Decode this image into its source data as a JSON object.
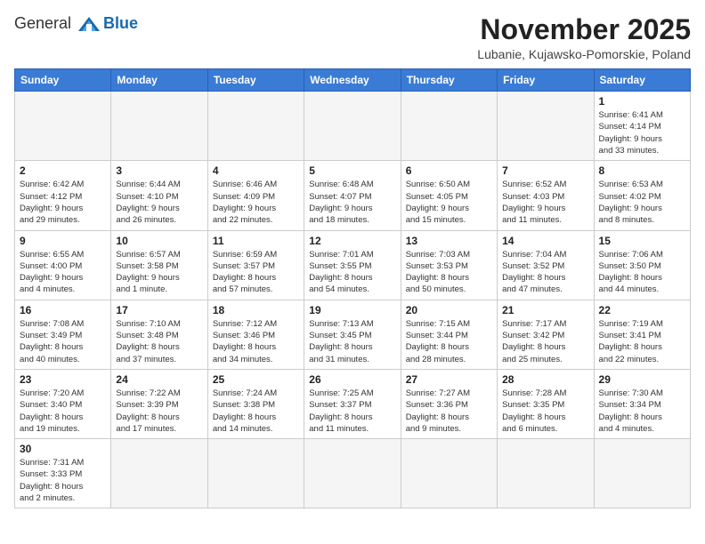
{
  "header": {
    "logo_general": "General",
    "logo_blue": "Blue",
    "title": "November 2025",
    "subtitle": "Lubanie, Kujawsko-Pomorskie, Poland"
  },
  "weekdays": [
    "Sunday",
    "Monday",
    "Tuesday",
    "Wednesday",
    "Thursday",
    "Friday",
    "Saturday"
  ],
  "days": [
    {
      "date": "",
      "info": ""
    },
    {
      "date": "",
      "info": ""
    },
    {
      "date": "",
      "info": ""
    },
    {
      "date": "",
      "info": ""
    },
    {
      "date": "",
      "info": ""
    },
    {
      "date": "",
      "info": ""
    },
    {
      "date": "1",
      "info": "Sunrise: 6:41 AM\nSunset: 4:14 PM\nDaylight: 9 hours\nand 33 minutes."
    },
    {
      "date": "2",
      "info": "Sunrise: 6:42 AM\nSunset: 4:12 PM\nDaylight: 9 hours\nand 29 minutes."
    },
    {
      "date": "3",
      "info": "Sunrise: 6:44 AM\nSunset: 4:10 PM\nDaylight: 9 hours\nand 26 minutes."
    },
    {
      "date": "4",
      "info": "Sunrise: 6:46 AM\nSunset: 4:09 PM\nDaylight: 9 hours\nand 22 minutes."
    },
    {
      "date": "5",
      "info": "Sunrise: 6:48 AM\nSunset: 4:07 PM\nDaylight: 9 hours\nand 18 minutes."
    },
    {
      "date": "6",
      "info": "Sunrise: 6:50 AM\nSunset: 4:05 PM\nDaylight: 9 hours\nand 15 minutes."
    },
    {
      "date": "7",
      "info": "Sunrise: 6:52 AM\nSunset: 4:03 PM\nDaylight: 9 hours\nand 11 minutes."
    },
    {
      "date": "8",
      "info": "Sunrise: 6:53 AM\nSunset: 4:02 PM\nDaylight: 9 hours\nand 8 minutes."
    },
    {
      "date": "9",
      "info": "Sunrise: 6:55 AM\nSunset: 4:00 PM\nDaylight: 9 hours\nand 4 minutes."
    },
    {
      "date": "10",
      "info": "Sunrise: 6:57 AM\nSunset: 3:58 PM\nDaylight: 9 hours\nand 1 minute."
    },
    {
      "date": "11",
      "info": "Sunrise: 6:59 AM\nSunset: 3:57 PM\nDaylight: 8 hours\nand 57 minutes."
    },
    {
      "date": "12",
      "info": "Sunrise: 7:01 AM\nSunset: 3:55 PM\nDaylight: 8 hours\nand 54 minutes."
    },
    {
      "date": "13",
      "info": "Sunrise: 7:03 AM\nSunset: 3:53 PM\nDaylight: 8 hours\nand 50 minutes."
    },
    {
      "date": "14",
      "info": "Sunrise: 7:04 AM\nSunset: 3:52 PM\nDaylight: 8 hours\nand 47 minutes."
    },
    {
      "date": "15",
      "info": "Sunrise: 7:06 AM\nSunset: 3:50 PM\nDaylight: 8 hours\nand 44 minutes."
    },
    {
      "date": "16",
      "info": "Sunrise: 7:08 AM\nSunset: 3:49 PM\nDaylight: 8 hours\nand 40 minutes."
    },
    {
      "date": "17",
      "info": "Sunrise: 7:10 AM\nSunset: 3:48 PM\nDaylight: 8 hours\nand 37 minutes."
    },
    {
      "date": "18",
      "info": "Sunrise: 7:12 AM\nSunset: 3:46 PM\nDaylight: 8 hours\nand 34 minutes."
    },
    {
      "date": "19",
      "info": "Sunrise: 7:13 AM\nSunset: 3:45 PM\nDaylight: 8 hours\nand 31 minutes."
    },
    {
      "date": "20",
      "info": "Sunrise: 7:15 AM\nSunset: 3:44 PM\nDaylight: 8 hours\nand 28 minutes."
    },
    {
      "date": "21",
      "info": "Sunrise: 7:17 AM\nSunset: 3:42 PM\nDaylight: 8 hours\nand 25 minutes."
    },
    {
      "date": "22",
      "info": "Sunrise: 7:19 AM\nSunset: 3:41 PM\nDaylight: 8 hours\nand 22 minutes."
    },
    {
      "date": "23",
      "info": "Sunrise: 7:20 AM\nSunset: 3:40 PM\nDaylight: 8 hours\nand 19 minutes."
    },
    {
      "date": "24",
      "info": "Sunrise: 7:22 AM\nSunset: 3:39 PM\nDaylight: 8 hours\nand 17 minutes."
    },
    {
      "date": "25",
      "info": "Sunrise: 7:24 AM\nSunset: 3:38 PM\nDaylight: 8 hours\nand 14 minutes."
    },
    {
      "date": "26",
      "info": "Sunrise: 7:25 AM\nSunset: 3:37 PM\nDaylight: 8 hours\nand 11 minutes."
    },
    {
      "date": "27",
      "info": "Sunrise: 7:27 AM\nSunset: 3:36 PM\nDaylight: 8 hours\nand 9 minutes."
    },
    {
      "date": "28",
      "info": "Sunrise: 7:28 AM\nSunset: 3:35 PM\nDaylight: 8 hours\nand 6 minutes."
    },
    {
      "date": "29",
      "info": "Sunrise: 7:30 AM\nSunset: 3:34 PM\nDaylight: 8 hours\nand 4 minutes."
    },
    {
      "date": "30",
      "info": "Sunrise: 7:31 AM\nSunset: 3:33 PM\nDaylight: 8 hours\nand 2 minutes."
    },
    {
      "date": "",
      "info": ""
    },
    {
      "date": "",
      "info": ""
    },
    {
      "date": "",
      "info": ""
    },
    {
      "date": "",
      "info": ""
    },
    {
      "date": "",
      "info": ""
    },
    {
      "date": "",
      "info": ""
    }
  ]
}
